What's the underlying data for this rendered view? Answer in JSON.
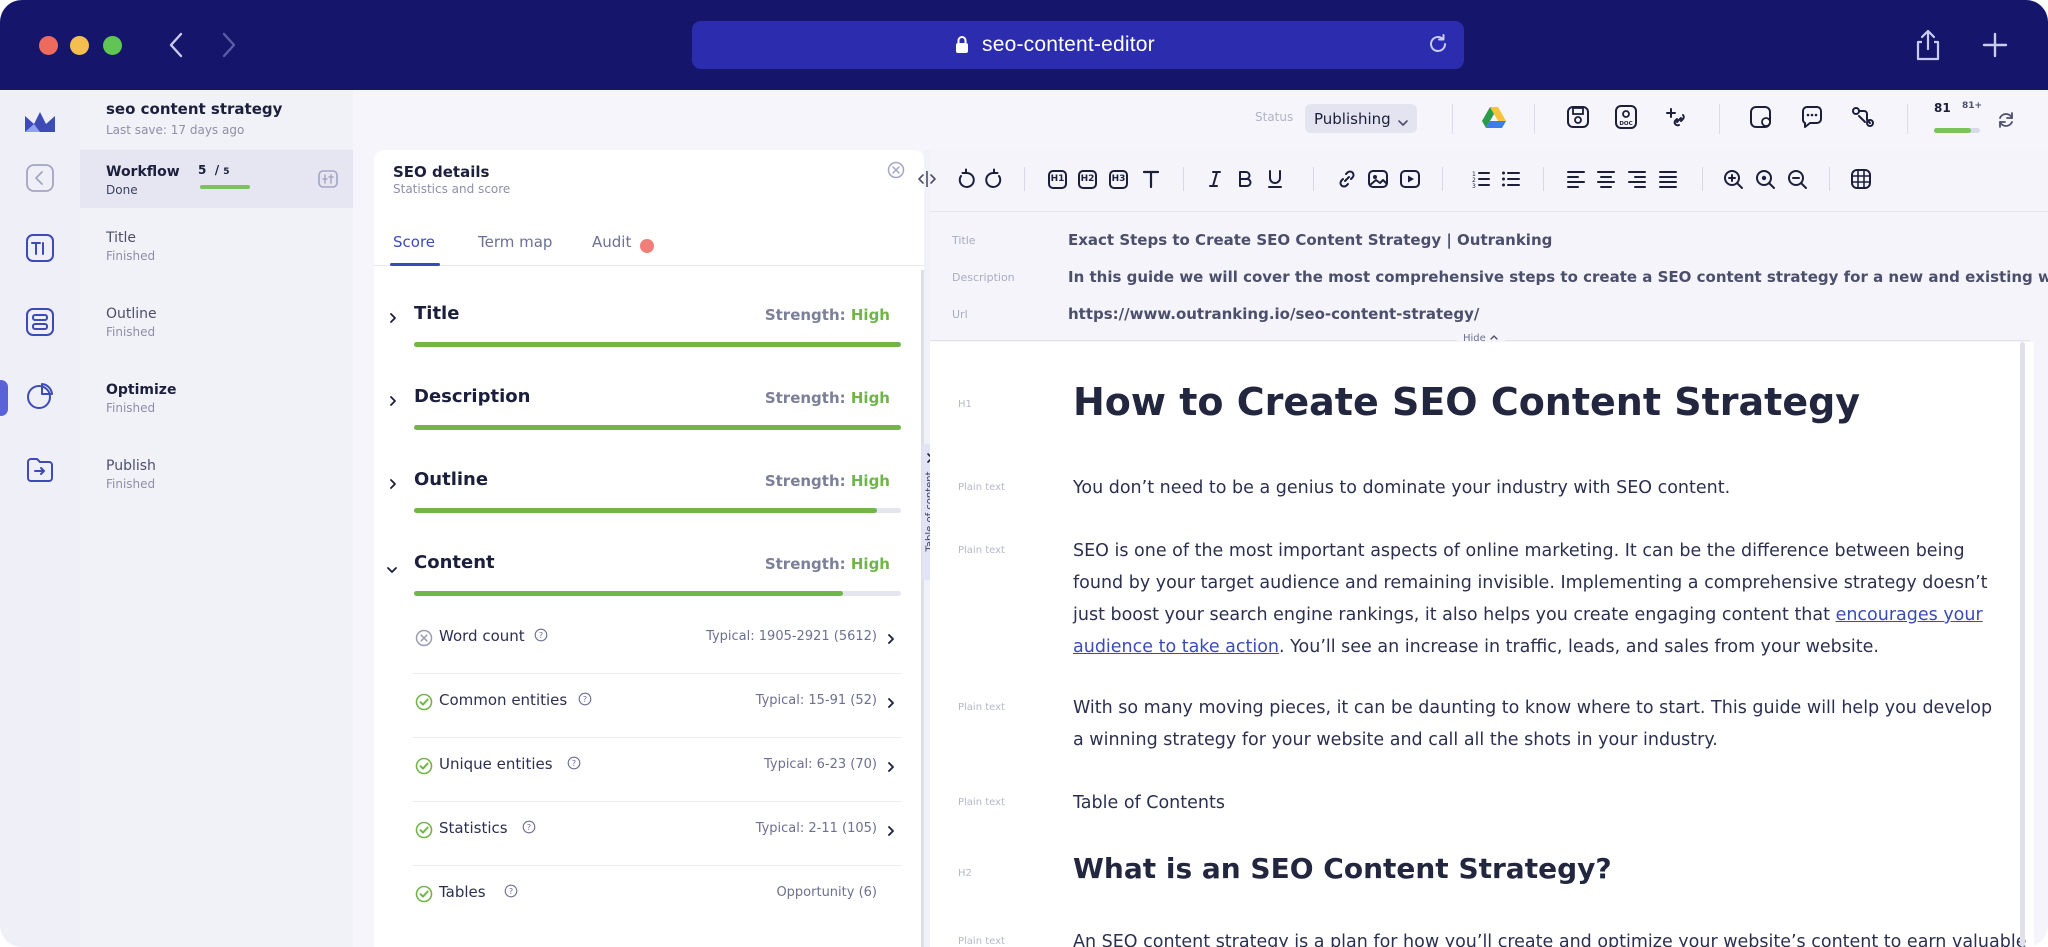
{
  "browser": {
    "url": "seo-content-editor"
  },
  "document": {
    "name": "seo content strategy",
    "last_save": "Last save: 17 days ago"
  },
  "workflow": {
    "title": "Workflow",
    "status": "Done",
    "count_current": "5",
    "count_total": "5",
    "progress": 1.0,
    "steps": [
      {
        "name": "Title",
        "status": "Finished"
      },
      {
        "name": "Outline",
        "status": "Finished"
      },
      {
        "name": "Optimize",
        "status": "Finished"
      },
      {
        "name": "Publish",
        "status": "Finished"
      }
    ]
  },
  "seo_panel": {
    "title": "SEO details",
    "subtitle": "Statistics and score",
    "tabs": [
      {
        "label": "Score"
      },
      {
        "label": "Term map"
      },
      {
        "label": "Audit"
      }
    ],
    "strength_label": "Strength:",
    "metrics": [
      {
        "name": "Title",
        "strength": "High",
        "fill": 1.0
      },
      {
        "name": "Description",
        "strength": "High",
        "fill": 1.0
      },
      {
        "name": "Outline",
        "strength": "High",
        "fill": 0.95
      },
      {
        "name": "Content",
        "strength": "High",
        "fill": 0.88
      }
    ],
    "content_items": [
      {
        "name": "Word count",
        "typical": "Typical:  1905-2921  (5612)",
        "state": "fail"
      },
      {
        "name": "Common entities",
        "typical": "Typical:  15-91  (52)",
        "state": "ok"
      },
      {
        "name": "Unique entities",
        "typical": "Typical:  6-23  (70)",
        "state": "ok"
      },
      {
        "name": "Statistics",
        "typical": "Typical:  2-11  (105)",
        "state": "ok"
      },
      {
        "name": "Tables",
        "typical": "Opportunity    (6)",
        "state": "ok"
      }
    ],
    "toc_label": "Table of content"
  },
  "top_bar": {
    "status_label": "Status",
    "status_value": "Publishing",
    "score": "81",
    "score_max": "81+",
    "score_fill": 0.8
  },
  "meta": {
    "title_key": "Title",
    "title_val": "Exact Steps to Create SEO Content Strategy | Outranking",
    "description_key": "Description",
    "description_val": "In this guide we will cover the most comprehensive steps to create a SEO content strategy for a new and existing website",
    "url_key": "Url",
    "url_val": "https://www.outranking.io/seo-content-strategy/",
    "hide_label": "Hide"
  },
  "editor": {
    "h1_type": "H1",
    "h1": "How to Create SEO Content Strategy",
    "plain_type": "Plain text",
    "p1": "You don’t need to be a genius to dominate your industry with SEO content.",
    "p2_a": "SEO is one of the most important aspects of online marketing. It can be the difference between being found by your target audience and remaining invisible. Implementing a comprehensive strategy doesn’t just boost your search engine rankings, it also helps you create engaging content that ",
    "p2_link": "encourages your audience to take action",
    "p2_b": ". You’ll see an increase in traffic, leads, and sales from your website.",
    "p3": "With so many moving pieces, it can be daunting to know where to start. This guide will help you develop a winning strategy for your website and call all the shots in your industry.",
    "p4": "Table of Contents",
    "h2_type": "H2",
    "h2": "What is an SEO Content Strategy?",
    "p5": "An SEO content strategy is a plan for how you’ll create and optimize your website’s content to earn valuable"
  },
  "colors": {
    "chrome": "#15166b",
    "addressbar": "#2b2dae",
    "accent": "#3a4bb8",
    "success": "#72b64a"
  }
}
